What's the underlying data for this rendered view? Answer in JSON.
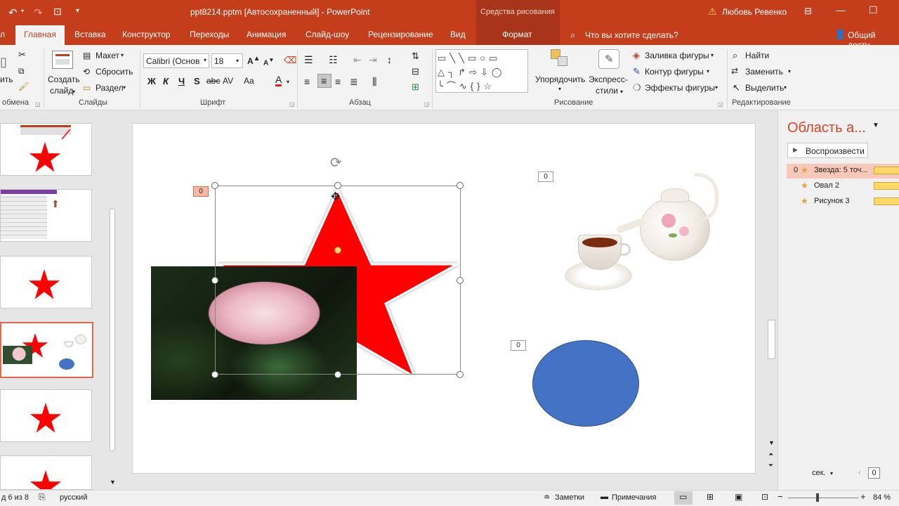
{
  "titlebar": {
    "doc_title": "ppt8214.pptm [Автосохраненный]  -  PowerPoint",
    "context_label": "Средства рисования",
    "user": "Любовь Ревенко"
  },
  "tabs": [
    {
      "label": "л"
    },
    {
      "label": "Главная"
    },
    {
      "label": "Вставка"
    },
    {
      "label": "Конструктор"
    },
    {
      "label": "Переходы"
    },
    {
      "label": "Анимация"
    },
    {
      "label": "Слайд-шоу"
    },
    {
      "label": "Рецензирование"
    },
    {
      "label": "Вид"
    },
    {
      "label": "Формат"
    }
  ],
  "search": {
    "placeholder": "Что вы хотите сделать?"
  },
  "share": "Общий досту",
  "ribbon": {
    "clipboard": {
      "paste_partial": "ить",
      "group": "обмена"
    },
    "slides": {
      "create_line1": "Создать",
      "create_line2": "слайд",
      "layout": "Макет",
      "reset": "Сбросить",
      "section": "Раздел",
      "group": "Слайды"
    },
    "font": {
      "name": "Calibri (Основ",
      "size": "18",
      "bold": "Ж",
      "italic": "К",
      "underline": "Ч",
      "strike": "S",
      "group": "Шрифт"
    },
    "paragraph": {
      "group": "Абзац"
    },
    "drawing": {
      "arrange": "Упорядочить",
      "quick_styles_line1": "Экспресс-",
      "quick_styles_line2": "стили",
      "fill": "Заливка фигуры",
      "outline": "Контур фигуры",
      "effects": "Эффекты фигуры",
      "group": "Рисование"
    },
    "editing": {
      "find": "Найти",
      "replace": "Заменить",
      "select": "Выделить",
      "group": "Редактирование"
    }
  },
  "slide": {
    "tag_star": "0",
    "tag_tea": "0",
    "tag_oval": "0"
  },
  "anim_pane": {
    "title": "Область а...",
    "play": "Воспроизвести",
    "items": [
      {
        "num": "0",
        "label": "Звезда: 5 точ..."
      },
      {
        "num": "",
        "label": "Овал 2"
      },
      {
        "num": "",
        "label": "Рисунок 3"
      }
    ],
    "sec": "сек.",
    "page": "0"
  },
  "status": {
    "slide_info": "д 6 из 8",
    "language": "русский",
    "notes": "Заметки",
    "comments": "Примечания",
    "zoom": "84 %"
  },
  "colors": {
    "accent": "#c43e1c",
    "star": "#ff0000",
    "oval": "#4472c4",
    "anim_bar": "#ffd966"
  }
}
